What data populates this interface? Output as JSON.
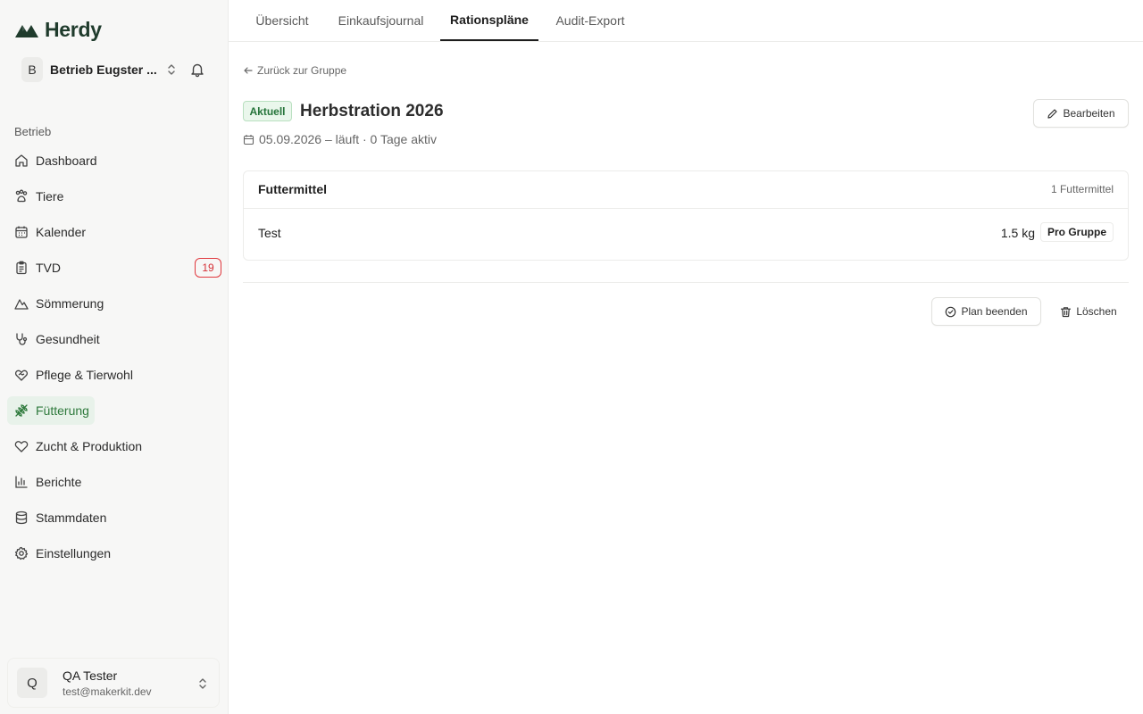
{
  "app": {
    "name": "Herdy",
    "brand_color": "#1f3b2c",
    "accent_color": "#2f7a3d"
  },
  "account": {
    "initial": "B",
    "name": "Betrieb Eugster ..."
  },
  "sidebar": {
    "section_label": "Betrieb",
    "items": [
      {
        "label": "Dashboard",
        "icon": "home-icon"
      },
      {
        "label": "Tiere",
        "icon": "paw-icon"
      },
      {
        "label": "Kalender",
        "icon": "calendar-icon"
      },
      {
        "label": "TVD",
        "icon": "clipboard-icon",
        "badge": "19"
      },
      {
        "label": "Sömmerung",
        "icon": "mountain-icon"
      },
      {
        "label": "Gesundheit",
        "icon": "stethoscope-icon"
      },
      {
        "label": "Pflege & Tierwohl",
        "icon": "heart-handshake-icon"
      },
      {
        "label": "Fütterung",
        "icon": "wheat-icon",
        "active": true
      },
      {
        "label": "Zucht & Produktion",
        "icon": "heart-icon"
      },
      {
        "label": "Berichte",
        "icon": "bar-chart-icon"
      },
      {
        "label": "Stammdaten",
        "icon": "database-icon"
      },
      {
        "label": "Einstellungen",
        "icon": "gear-icon"
      }
    ]
  },
  "user": {
    "initial": "Q",
    "name": "QA Tester",
    "email": "test@makerkit.dev"
  },
  "tabs": [
    {
      "label": "Übersicht"
    },
    {
      "label": "Einkaufsjournal"
    },
    {
      "label": "Rationspläne",
      "active": true
    },
    {
      "label": "Audit-Export"
    }
  ],
  "main": {
    "back_label": "Zurück zur Gruppe",
    "status": "Aktuell",
    "title": "Herbstration 2026",
    "date_info": "05.09.2026 – läuft · 0 Tage aktiv",
    "edit_label": "Bearbeiten",
    "feed_card": {
      "title": "Futtermittel",
      "count": "1 Futtermittel",
      "rows": [
        {
          "name": "Test",
          "amount": "1.5 kg",
          "scope": "Pro Gruppe"
        }
      ]
    },
    "end_plan_label": "Plan beenden",
    "delete_label": "Löschen"
  }
}
